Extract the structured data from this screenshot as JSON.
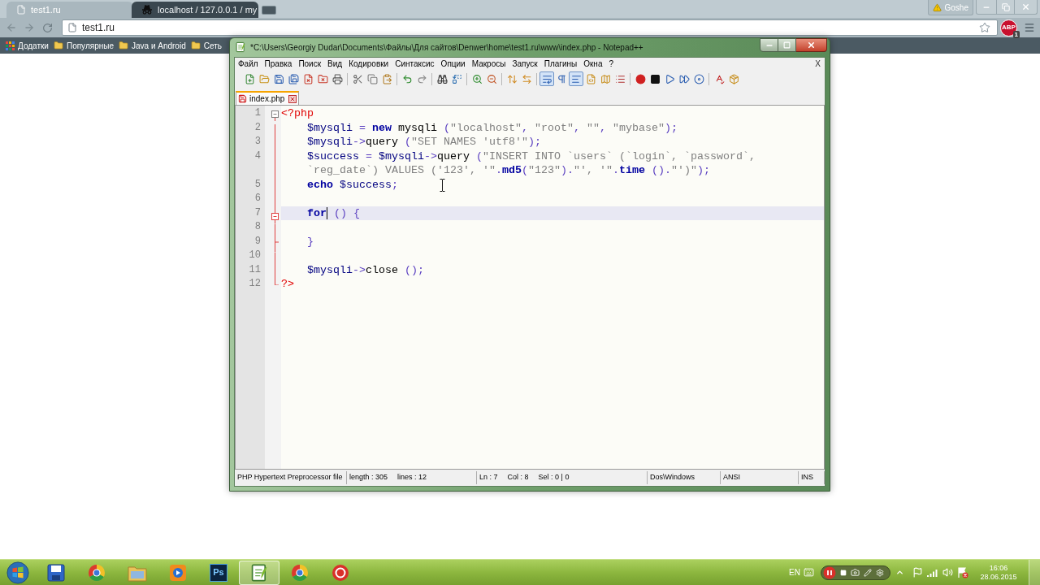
{
  "browser": {
    "tabs": [
      {
        "title": "test1.ru",
        "selected": true
      },
      {
        "title": "localhost / 127.0.0.1 / my",
        "selected": false
      }
    ],
    "profile": "Goshe",
    "address": "test1.ru",
    "extension": {
      "label": "ABP",
      "count": "1"
    },
    "bookmarks": [
      {
        "kind": "apps",
        "label": "Додатки"
      },
      {
        "kind": "folder",
        "label": "Популярные"
      },
      {
        "kind": "folder",
        "label": "Java и Android"
      },
      {
        "kind": "folder",
        "label": "Сеть"
      }
    ]
  },
  "editor_window": {
    "title": "*C:\\Users\\Georgiy Dudar\\Documents\\Файлы\\Для сайтов\\Denwer\\home\\test1.ru\\www\\index.php - Notepad++",
    "menu": [
      "Файл",
      "Правка",
      "Поиск",
      "Вид",
      "Кодировки",
      "Синтаксис",
      "Опции",
      "Макросы",
      "Запуск",
      "Плагины",
      "Окна",
      "?"
    ],
    "menu_close": "X",
    "toolbar": [
      [
        {
          "kind": "new",
          "pressed": false
        },
        {
          "kind": "open",
          "pressed": false
        },
        {
          "kind": "save",
          "pressed": false
        },
        {
          "kind": "saveall",
          "pressed": false
        },
        {
          "kind": "close",
          "pressed": false
        },
        {
          "kind": "closeall",
          "pressed": false
        },
        {
          "kind": "print",
          "pressed": false
        }
      ],
      [
        {
          "kind": "cut",
          "pressed": false
        },
        {
          "kind": "copy",
          "pressed": false
        },
        {
          "kind": "paste",
          "pressed": false
        }
      ],
      [
        {
          "kind": "undo",
          "pressed": false
        },
        {
          "kind": "redo",
          "pressed": false
        }
      ],
      [
        {
          "kind": "find",
          "pressed": false
        },
        {
          "kind": "replace",
          "pressed": false
        }
      ],
      [
        {
          "kind": "zoomin",
          "pressed": false
        },
        {
          "kind": "zoomout",
          "pressed": false
        }
      ],
      [
        {
          "kind": "syncv",
          "pressed": false
        },
        {
          "kind": "synch",
          "pressed": false
        }
      ],
      [
        {
          "kind": "wrap",
          "pressed": true
        },
        {
          "kind": "allchars",
          "pressed": false
        },
        {
          "kind": "indent",
          "pressed": true
        },
        {
          "kind": "language",
          "pressed": false
        },
        {
          "kind": "docmap",
          "pressed": false
        },
        {
          "kind": "funclist",
          "pressed": false
        }
      ],
      [
        {
          "kind": "record",
          "pressed": false
        },
        {
          "kind": "stop",
          "pressed": false
        },
        {
          "kind": "play",
          "pressed": false
        },
        {
          "kind": "playmulti",
          "pressed": false
        },
        {
          "kind": "savemacro",
          "pressed": false
        }
      ],
      [
        {
          "kind": "spellcheck",
          "pressed": false
        },
        {
          "kind": "plugin",
          "pressed": false
        }
      ]
    ],
    "tabs": [
      {
        "label": "index.php",
        "selected": true,
        "modified": true
      }
    ],
    "lines": [
      {
        "number": "1",
        "kind": "foldstart",
        "current": false,
        "rows": [
          {
            "tokens": [
              {
                "kind": "tag",
                "text": "<?php"
              }
            ]
          }
        ]
      },
      {
        "number": "2",
        "kind": "guide",
        "current": false,
        "rows": [
          {
            "indent": "    ",
            "tokens": [
              {
                "kind": "variable",
                "text": "$mysqli"
              },
              {
                "kind": "operator",
                "text": " = "
              },
              {
                "kind": "keyword",
                "text": "new"
              },
              {
                "kind": "plain",
                "text": " mysqli "
              },
              {
                "kind": "operator",
                "text": "("
              },
              {
                "kind": "string",
                "text": "\"localhost\""
              },
              {
                "kind": "operator",
                "text": ", "
              },
              {
                "kind": "string",
                "text": "\"root\""
              },
              {
                "kind": "operator",
                "text": ", "
              },
              {
                "kind": "string",
                "text": "\"\""
              },
              {
                "kind": "operator",
                "text": ", "
              },
              {
                "kind": "string",
                "text": "\"mybase\""
              },
              {
                "kind": "operator",
                "text": ");"
              }
            ]
          }
        ]
      },
      {
        "number": "3",
        "kind": "guide",
        "current": false,
        "rows": [
          {
            "indent": "    ",
            "tokens": [
              {
                "kind": "variable",
                "text": "$mysqli"
              },
              {
                "kind": "operator",
                "text": "->"
              },
              {
                "kind": "plain",
                "text": "query"
              },
              {
                "kind": "operator",
                "text": " ("
              },
              {
                "kind": "string",
                "text": "\"SET NAMES 'utf8'\""
              },
              {
                "kind": "operator",
                "text": ");"
              }
            ]
          }
        ]
      },
      {
        "number": "4",
        "kind": "guide",
        "current": false,
        "rows": [
          {
            "indent": "    ",
            "tokens": [
              {
                "kind": "variable",
                "text": "$success"
              },
              {
                "kind": "operator",
                "text": " = "
              },
              {
                "kind": "variable",
                "text": "$mysqli"
              },
              {
                "kind": "operator",
                "text": "->"
              },
              {
                "kind": "plain",
                "text": "query"
              },
              {
                "kind": "operator",
                "text": " ("
              },
              {
                "kind": "string",
                "text": "\"INSERT INTO `users` (`login`, `password`,"
              }
            ]
          },
          {
            "indent": "    ",
            "tokens": [
              {
                "kind": "string",
                "text": "`reg_date`) VALUES ('123', '\""
              },
              {
                "kind": "operator",
                "text": "."
              },
              {
                "kind": "keyword",
                "text": "md5"
              },
              {
                "kind": "operator",
                "text": "("
              },
              {
                "kind": "string",
                "text": "\"123\""
              },
              {
                "kind": "operator",
                "text": ")."
              },
              {
                "kind": "string",
                "text": "\"', '\""
              },
              {
                "kind": "operator",
                "text": "."
              },
              {
                "kind": "keyword",
                "text": "time"
              },
              {
                "kind": "operator",
                "text": " ()."
              },
              {
                "kind": "string",
                "text": "\"')\""
              },
              {
                "kind": "operator",
                "text": ");"
              }
            ]
          }
        ]
      },
      {
        "number": "5",
        "kind": "guide",
        "current": false,
        "rows": [
          {
            "indent": "    ",
            "tokens": [
              {
                "kind": "keyword",
                "text": "echo "
              },
              {
                "kind": "variable",
                "text": "$success"
              },
              {
                "kind": "operator",
                "text": ";"
              }
            ]
          }
        ]
      },
      {
        "number": "6",
        "kind": "guide",
        "current": false
      },
      {
        "number": "7",
        "kind": "innerstart",
        "current": true,
        "rows": [
          {
            "indent": "    ",
            "tokens": [
              {
                "kind": "keyword",
                "text": "for"
              },
              {
                "kind": "caret"
              },
              {
                "kind": "operator",
                "text": " () {"
              }
            ]
          }
        ]
      },
      {
        "number": "8",
        "kind": "guide",
        "current": false
      },
      {
        "number": "9",
        "kind": "innerend",
        "current": false,
        "rows": [
          {
            "indent": "    ",
            "tokens": [
              {
                "kind": "operator",
                "text": "}"
              }
            ]
          }
        ]
      },
      {
        "number": "10",
        "kind": "guide",
        "current": false
      },
      {
        "number": "11",
        "kind": "guide",
        "current": false,
        "rows": [
          {
            "indent": "    ",
            "tokens": [
              {
                "kind": "variable",
                "text": "$mysqli"
              },
              {
                "kind": "operator",
                "text": "->"
              },
              {
                "kind": "plain",
                "text": "close"
              },
              {
                "kind": "operator",
                "text": " ();"
              }
            ]
          }
        ]
      },
      {
        "number": "12",
        "kind": "foldend",
        "current": false,
        "rows": [
          {
            "tokens": [
              {
                "kind": "tag",
                "text": "?>"
              }
            ]
          }
        ]
      }
    ],
    "status_bar": [
      {
        "texts": [
          "PHP Hypertext Preprocessor file"
        ]
      },
      {
        "texts": [
          "length : 305",
          "lines : 12"
        ]
      },
      {
        "texts": [
          "Ln : 7",
          "Col : 8",
          "Sel : 0 | 0"
        ]
      },
      {
        "texts": [
          "Dos\\Windows"
        ]
      },
      {
        "texts": [
          "ANSI"
        ]
      },
      {
        "texts": [
          "INS"
        ]
      }
    ]
  },
  "taskbar": {
    "apps": [
      {
        "kind": "floppy",
        "active": false
      },
      {
        "kind": "browser",
        "active": false
      },
      {
        "kind": "folder",
        "active": false
      },
      {
        "kind": "media",
        "active": false
      },
      {
        "kind": "tile",
        "label": "Ps",
        "active": false
      },
      {
        "kind": "notepad",
        "active": true
      },
      {
        "kind": "browser",
        "active": false
      },
      {
        "kind": "record",
        "active": false
      }
    ],
    "language": "EN",
    "time": "16:06",
    "date": "28.06.2015"
  }
}
